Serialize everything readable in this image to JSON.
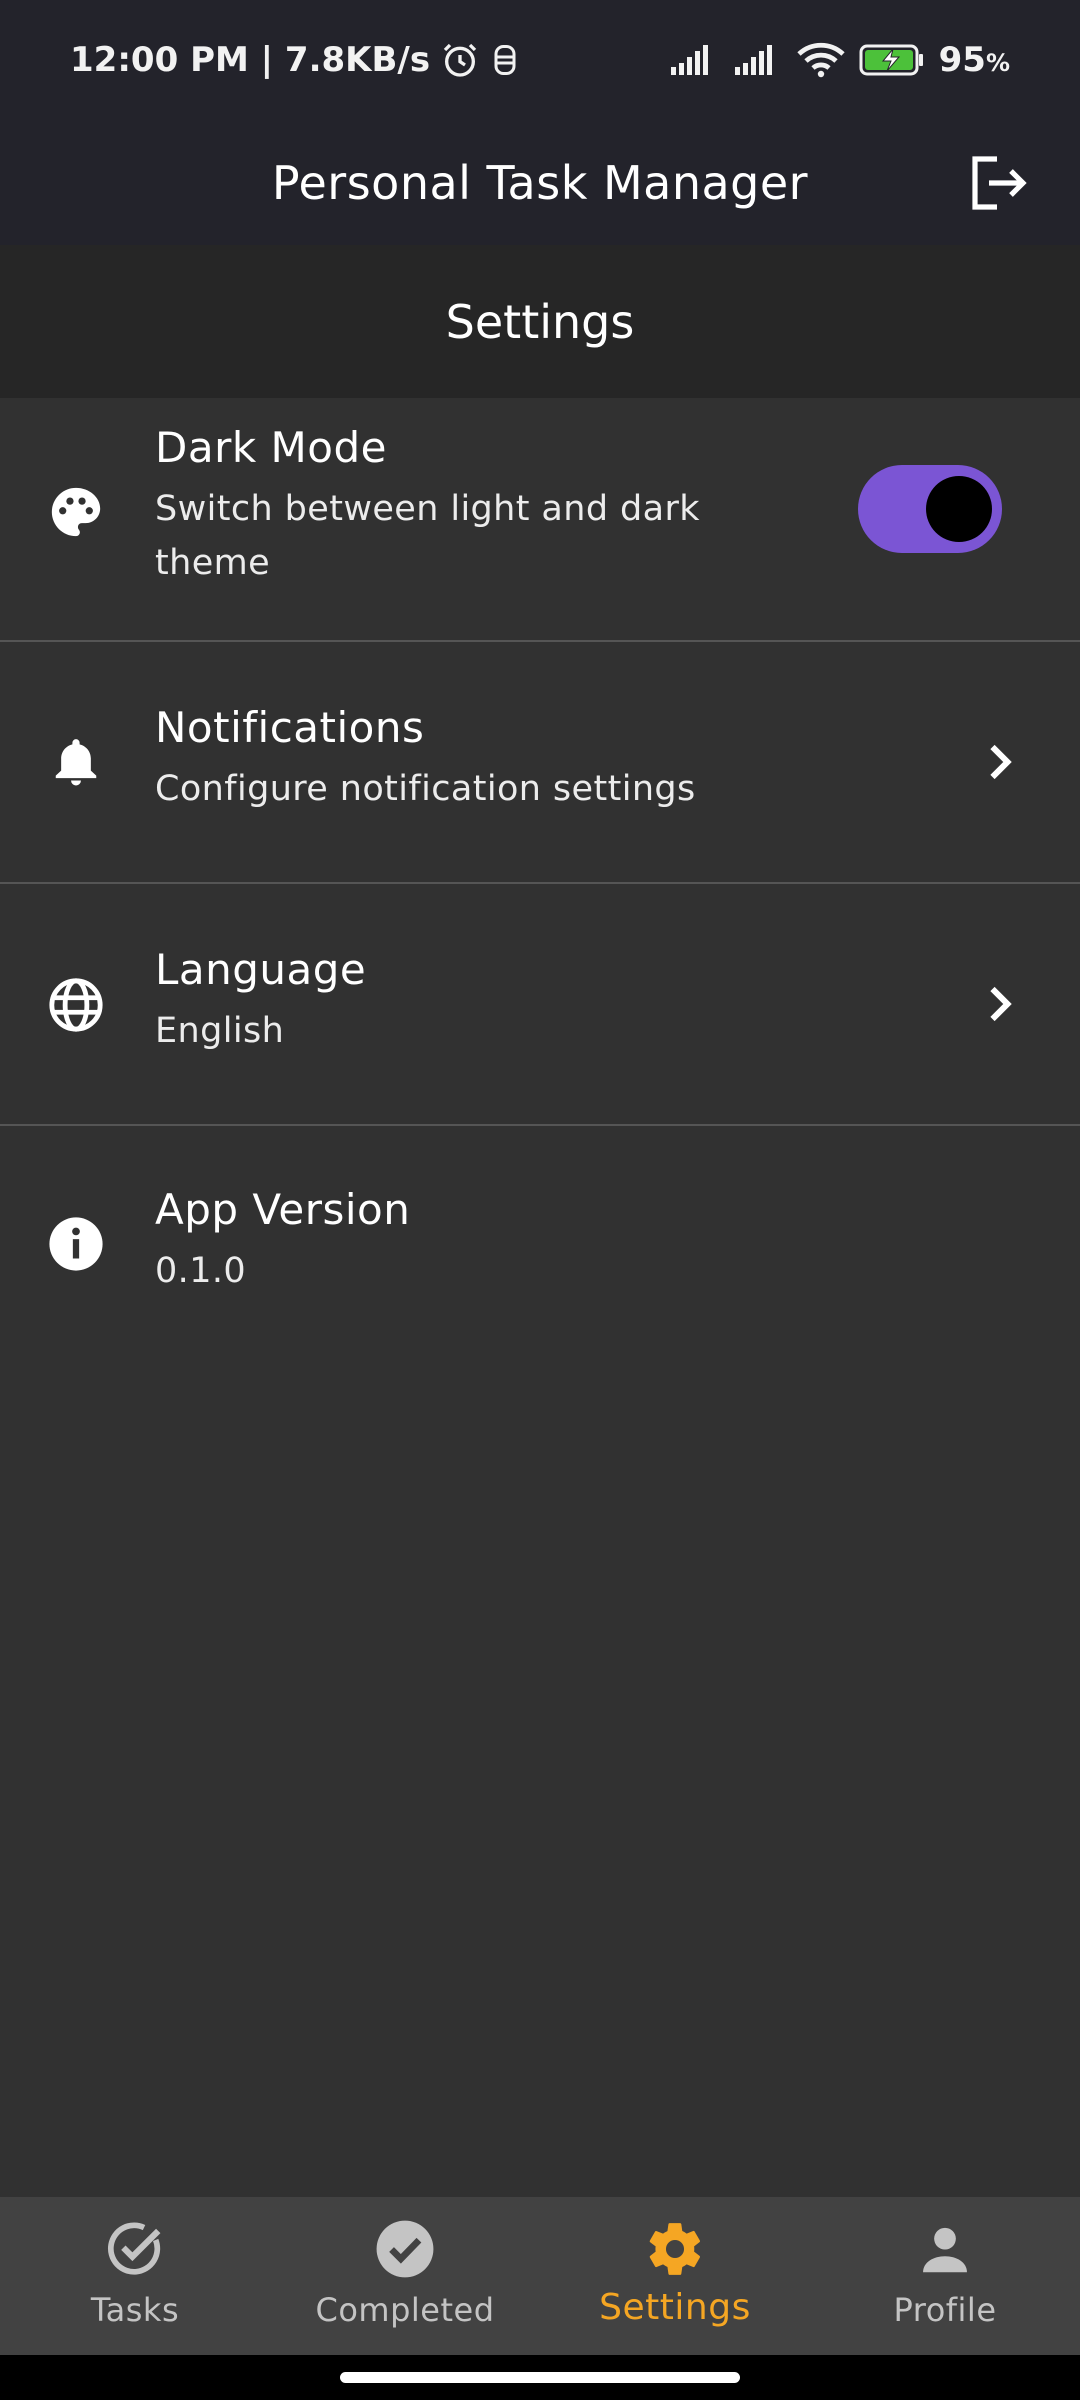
{
  "status_bar": {
    "time_speed": "12:00 PM | 7.8KB/s",
    "battery": "95",
    "battery_unit": "%"
  },
  "app_bar": {
    "title": "Personal Task Manager"
  },
  "section": {
    "title": "Settings"
  },
  "settings": [
    {
      "title": "Dark Mode",
      "subtitle": "Switch between light and dark theme",
      "icon": "palette-icon",
      "control": "toggle",
      "toggle_on": true
    },
    {
      "title": "Notifications",
      "subtitle": "Configure notification settings",
      "icon": "bell-icon",
      "control": "chevron"
    },
    {
      "title": "Language",
      "subtitle": "English",
      "icon": "globe-icon",
      "control": "chevron"
    },
    {
      "title": "App Version",
      "subtitle": "0.1.0",
      "icon": "info-icon",
      "control": "none"
    }
  ],
  "bottom_nav": {
    "active": "Settings",
    "items": [
      {
        "label": "Tasks",
        "icon": "check-circle-outline-icon"
      },
      {
        "label": "Completed",
        "icon": "check-circle-filled-icon"
      },
      {
        "label": "Settings",
        "icon": "gear-icon"
      },
      {
        "label": "Profile",
        "icon": "person-icon"
      }
    ]
  },
  "colors": {
    "background": "#313131",
    "app_bar": "#23232b",
    "toggle_track": "#7b55d4",
    "active_nav": "#f5a623",
    "nav_bar": "#424242"
  }
}
